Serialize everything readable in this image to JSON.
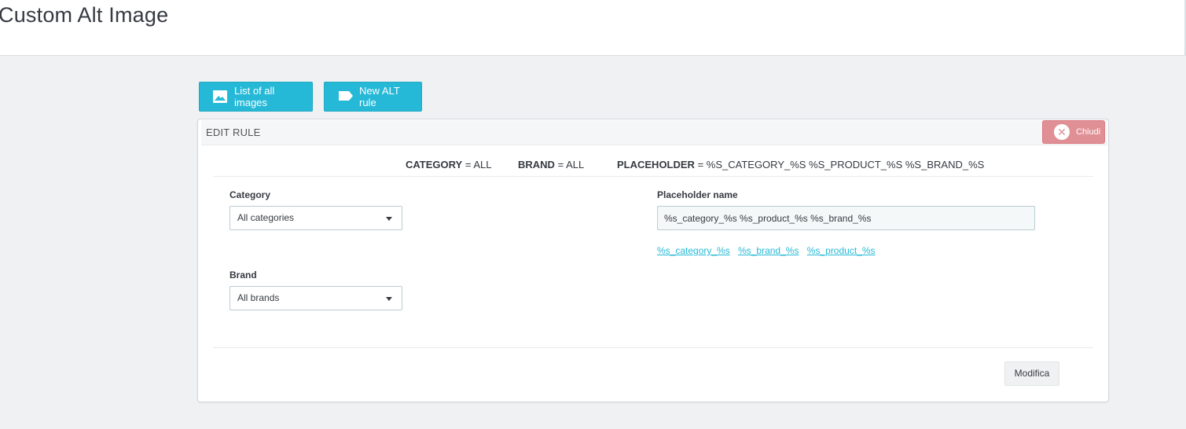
{
  "header": {
    "title": "Custom Alt Image"
  },
  "toolbar": {
    "list_label": "List of all images",
    "new_label": "New ALT rule"
  },
  "panel": {
    "heading": "EDIT RULE",
    "close_label": "Chiudi"
  },
  "summary": {
    "category_key": "CATEGORY",
    "category_value": "= ALL",
    "brand_key": "BRAND",
    "brand_value": "= ALL",
    "placeholder_key": "PLACEHOLDER",
    "placeholder_value": "= %S_CATEGORY_%S %S_PRODUCT_%S %S_BRAND_%S"
  },
  "form": {
    "category_label": "Category",
    "category_selected": "All categories",
    "brand_label": "Brand",
    "brand_selected": "All brands",
    "placeholder_label": "Placeholder name",
    "placeholder_value": "%s_category_%s %s_product_%s %s_brand_%s",
    "tokens": [
      "%s_category_%s",
      "%s_brand_%s",
      "%s_product_%s"
    ],
    "submit_label": "Modifica"
  },
  "colors": {
    "accent": "#25b9d7",
    "close": "#e08f95",
    "background": "#eff1f2"
  },
  "icons": {
    "list_button": "image-icon",
    "new_button": "tag-icon",
    "close_button": "close-circle-icon",
    "select_caret": "caret-down-icon"
  }
}
